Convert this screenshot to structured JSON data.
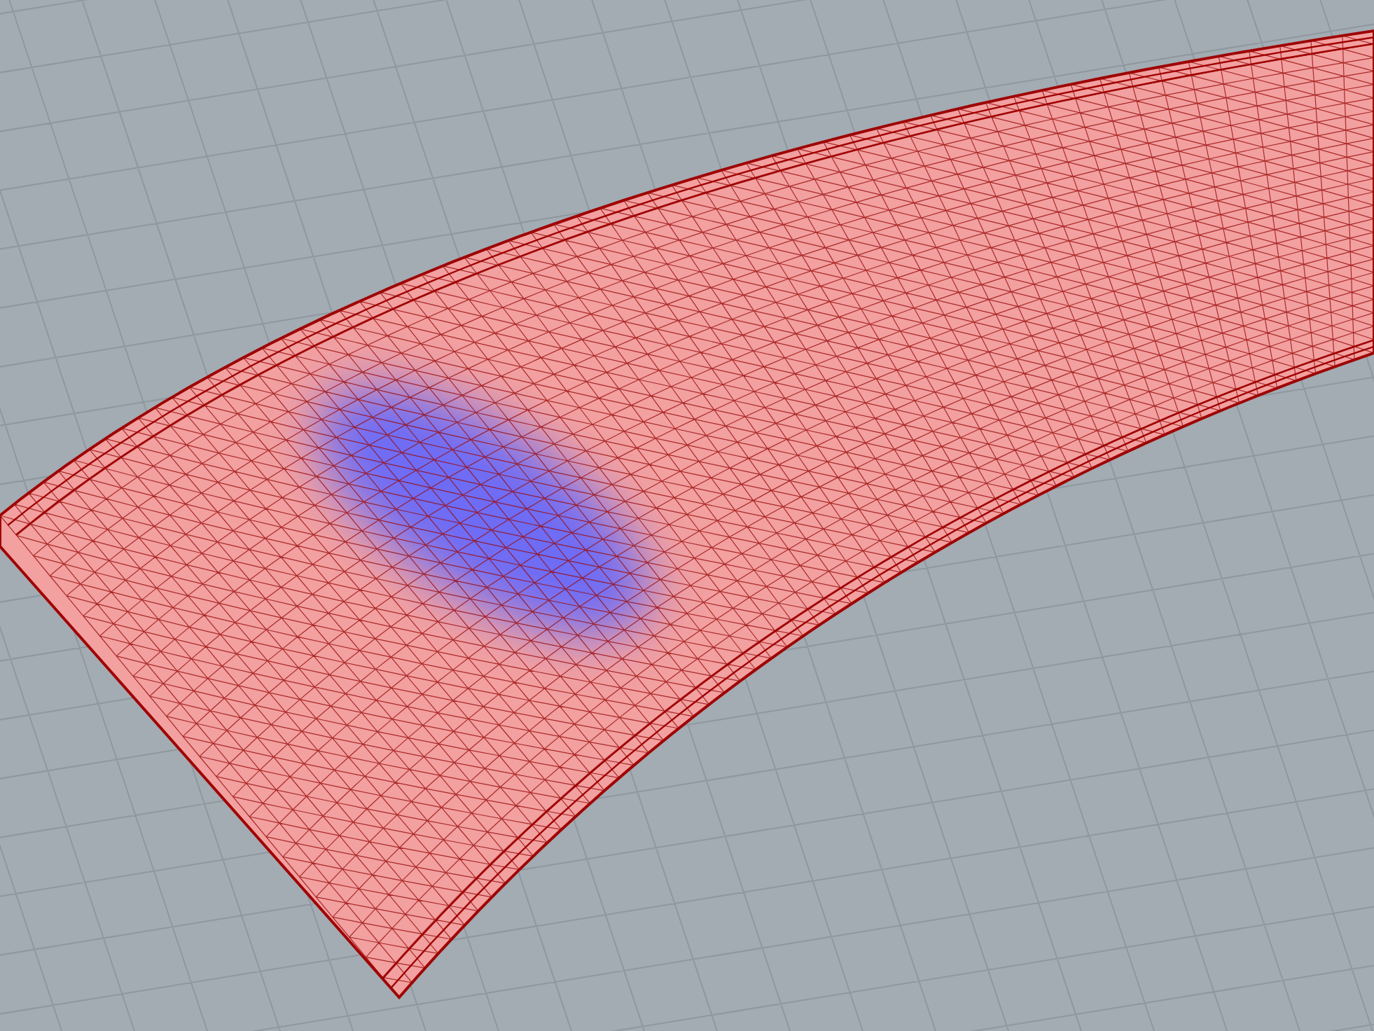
{
  "viewport": {
    "grid": true,
    "mesh_wireframe": true
  }
}
